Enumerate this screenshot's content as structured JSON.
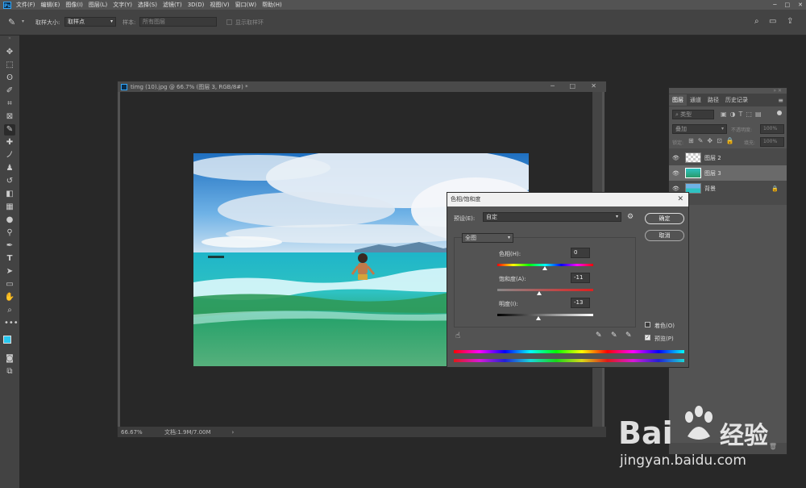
{
  "app": {
    "logo": "Ps"
  },
  "menu": [
    "文件(F)",
    "编辑(E)",
    "图像(I)",
    "图层(L)",
    "文字(Y)",
    "选择(S)",
    "滤镜(T)",
    "3D(D)",
    "视图(V)",
    "窗口(W)",
    "帮助(H)"
  ],
  "options": {
    "sample_size_label": "取样大小:",
    "sample_size_value": "取样点",
    "sample_label": "样本:",
    "sample_value": "所有图层",
    "show_ring": "显示取样环"
  },
  "document": {
    "title": "timg (10).jpg @ 66.7% (图层 3, RGB/8#) *",
    "zoom": "66.67%",
    "doc_info": "文档:1.9M/7.00M"
  },
  "layers": {
    "tabs": [
      "图层",
      "通道",
      "路径",
      "历史记录"
    ],
    "filter_placeholder": "类型",
    "blend_mode": "叠加",
    "opacity_label": "不透明度:",
    "opacity_value": "100%",
    "lock_label": "锁定:",
    "fill_label": "填充:",
    "fill_value": "100%",
    "items": [
      {
        "name": "图层 2"
      },
      {
        "name": "图层 3"
      },
      {
        "name": "背景"
      }
    ]
  },
  "dialog": {
    "title": "色相/饱和度",
    "preset_label": "预设(E):",
    "preset_value": "自定",
    "channel": "全图",
    "hue_label": "色相(H):",
    "hue_value": "0",
    "sat_label": "饱和度(A):",
    "sat_value": "-11",
    "light_label": "明度(I):",
    "light_value": "-13",
    "ok": "确定",
    "cancel": "取消",
    "colorize": "着色(O)",
    "preview": "预览(P)"
  },
  "watermark": {
    "brand_a": "Bai",
    "brand_b": "经验",
    "url": "jingyan.baidu.com"
  },
  "colors": {
    "accent": "#31a8ff",
    "foreground": "#28c8f0",
    "background": "#ffffff"
  }
}
